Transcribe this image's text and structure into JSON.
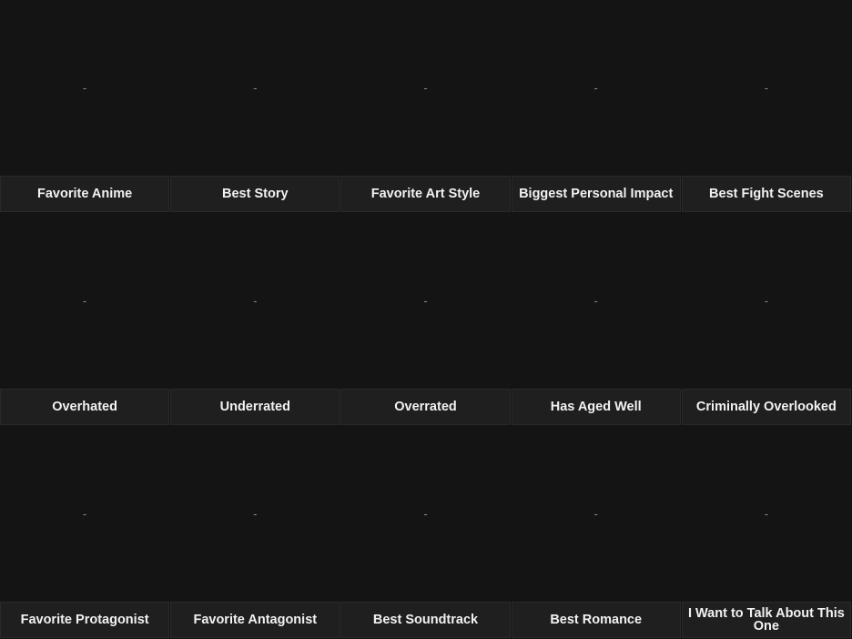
{
  "tiles": [
    {
      "label": "Favorite Anime",
      "placeholder": "-"
    },
    {
      "label": "Best Story",
      "placeholder": "-"
    },
    {
      "label": "Favorite Art Style",
      "placeholder": "-"
    },
    {
      "label": "Biggest Personal Impact",
      "placeholder": "-"
    },
    {
      "label": "Best Fight Scenes",
      "placeholder": "-"
    },
    {
      "label": "Overhated",
      "placeholder": "-"
    },
    {
      "label": "Underrated",
      "placeholder": "-"
    },
    {
      "label": "Overrated",
      "placeholder": "-"
    },
    {
      "label": "Has Aged Well",
      "placeholder": "-"
    },
    {
      "label": "Criminally Overlooked",
      "placeholder": "-"
    },
    {
      "label": "Favorite Protagonist",
      "placeholder": "-"
    },
    {
      "label": "Favorite Antagonist",
      "placeholder": "-"
    },
    {
      "label": "Best Soundtrack",
      "placeholder": "-"
    },
    {
      "label": "Best Romance",
      "placeholder": "-"
    },
    {
      "label": "I Want to Talk About This One",
      "placeholder": "-"
    }
  ],
  "colors": {
    "background": "#141414",
    "label_background": "#1f1f1f",
    "label_text": "#f2f2f2",
    "placeholder_text": "#8a8a8a"
  }
}
